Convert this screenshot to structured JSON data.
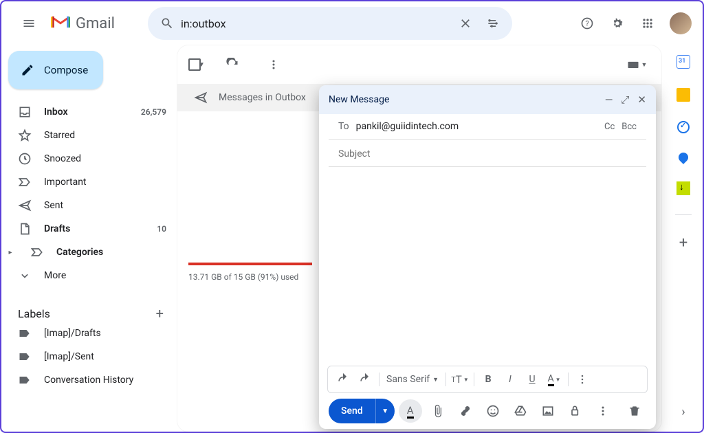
{
  "header": {
    "logo_text": "Gmail",
    "search_value": "in:outbox"
  },
  "compose_label": "Compose",
  "nav": [
    {
      "icon": "inbox",
      "label": "Inbox",
      "count": "26,579",
      "bold": true
    },
    {
      "icon": "star",
      "label": "Starred"
    },
    {
      "icon": "clock",
      "label": "Snoozed"
    },
    {
      "icon": "important",
      "label": "Important"
    },
    {
      "icon": "send",
      "label": "Sent"
    },
    {
      "icon": "draft",
      "label": "Drafts",
      "count": "10",
      "bold": true
    },
    {
      "icon": "category",
      "label": "Categories",
      "bold": true,
      "expandable": true
    },
    {
      "icon": "more",
      "label": "More"
    }
  ],
  "labels_header": "Labels",
  "labels": [
    {
      "label": "[Imap]/Drafts"
    },
    {
      "label": "[Imap]/Sent"
    },
    {
      "label": "Conversation History"
    }
  ],
  "outbox_banner": "Messages in Outbox",
  "storage": "13.71 GB of 15 GB (91%) used",
  "composer": {
    "title": "New Message",
    "to_label": "To",
    "to_value": "pankil@guiidintech.com",
    "cc": "Cc",
    "bcc": "Bcc",
    "subject_placeholder": "Subject",
    "font_name": "Sans Serif",
    "send_label": "Send"
  }
}
